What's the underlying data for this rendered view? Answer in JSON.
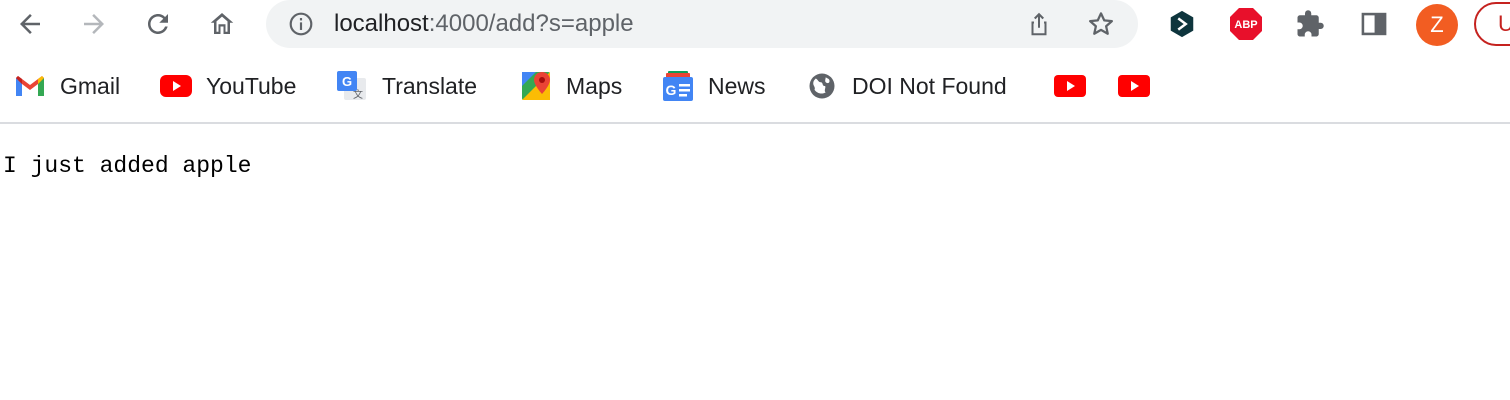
{
  "browser": {
    "url_host": "localhost",
    "url_path": ":4000/add?s=apple",
    "profile_initial": "Z",
    "update_label": "U"
  },
  "extensions": [
    {
      "name": "Dashlane"
    },
    {
      "name": "Adblock Plus",
      "badge": "ABP"
    },
    {
      "name": "Extensions"
    },
    {
      "name": "Side panel"
    }
  ],
  "bookmarks": [
    {
      "label": "Gmail",
      "icon": "gmail-icon"
    },
    {
      "label": "YouTube",
      "icon": "youtube-icon"
    },
    {
      "label": "Translate",
      "icon": "translate-icon"
    },
    {
      "label": "Maps",
      "icon": "maps-icon"
    },
    {
      "label": "News",
      "icon": "news-icon"
    },
    {
      "label": "DOI Not Found",
      "icon": "globe-icon"
    },
    {
      "label": "",
      "icon": "youtube-icon"
    },
    {
      "label": "",
      "icon": "youtube-icon"
    }
  ],
  "page": {
    "message": "I just added apple"
  },
  "colors": {
    "youtube_red": "#ff0000",
    "avatar_orange": "#f25d22",
    "omnibox_bg": "#f1f3f4"
  }
}
